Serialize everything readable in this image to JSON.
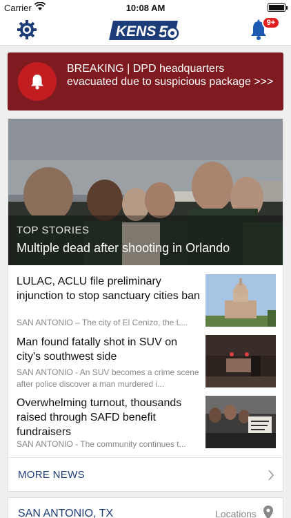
{
  "status_bar": {
    "carrier": "Carrier",
    "time": "10:08 AM",
    "battery_level": 1.0
  },
  "nav": {
    "logo_text": "KENS5",
    "notification_count": "9+"
  },
  "breaking": {
    "text": "BREAKING | DPD headquarters evacuated due to suspicious package >>>"
  },
  "hero": {
    "section": "TOP STORIES",
    "headline": "Multiple dead after shooting in Orlando"
  },
  "stories": [
    {
      "title": "LULAC, ACLU file preliminary injunction to stop sanctuary cities ban",
      "snippet": "SAN ANTONIO – The city of El Cenizo, the L..."
    },
    {
      "title": "Man found fatally shot in SUV on city's southwest side",
      "snippet": "SAN ANTONIO - An SUV becomes a crime scene after police discover a man murdered i..."
    },
    {
      "title": "Overwhelming turnout, thousands raised through SAFD benefit fundraisers",
      "snippet": "SAN ANTONIO - The community continues t..."
    }
  ],
  "more_news": {
    "label": "MORE NEWS"
  },
  "location": {
    "city": "SAN ANTONIO, TX",
    "action": "Locations"
  },
  "colors": {
    "breaking_bg": "#7d1b20",
    "accent_blue": "#1d3d78",
    "alert_red": "#e02020"
  }
}
